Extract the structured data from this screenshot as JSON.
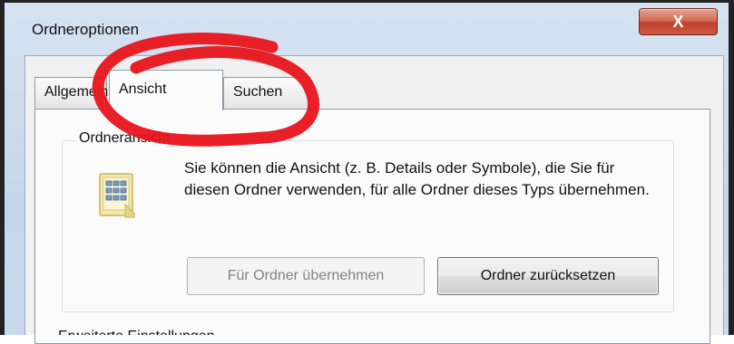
{
  "window": {
    "title": "Ordneroptionen",
    "close_label": "X"
  },
  "tabs": [
    {
      "label": "Allgemein"
    },
    {
      "label": "Ansicht"
    },
    {
      "label": "Suchen"
    }
  ],
  "folder_view": {
    "group_label": "Ordneransicht",
    "description": "Sie können die Ansicht (z. B. Details oder Symbole), die Sie für diesen Ordner verwenden, für alle Ordner dieses Typs übernehmen.",
    "apply_button": "Für Ordner übernehmen",
    "reset_button": "Ordner zurücksetzen"
  },
  "advanced": {
    "group_label": "Erweiterte Einstellungen"
  },
  "colors": {
    "annotation_red": "#e8141b",
    "close_red": "#c0412c"
  }
}
